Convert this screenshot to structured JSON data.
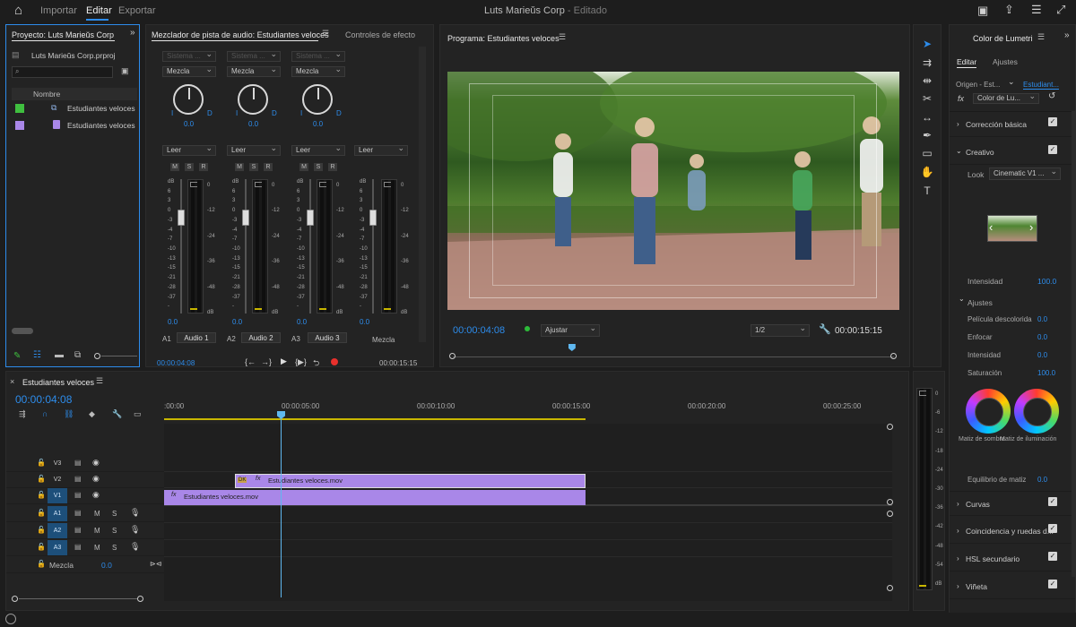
{
  "header": {
    "nav": [
      "Importar",
      "Editar",
      "Exportar"
    ],
    "title": "Luts Marieŭs Corp",
    "title_status": " - Editado"
  },
  "project": {
    "tab": "Proyecto: Luts Marieŭs Corp",
    "file": "Luts Marieŭs Corp.prproj",
    "column": "Nombre",
    "items": [
      {
        "name": "Estudiantes veloces",
        "color": "#3fbf3f"
      },
      {
        "name": "Estudiantes veloces",
        "color": "#a987e8"
      }
    ]
  },
  "mixer": {
    "tab": "Mezclador de pista de audio: Estudiantes veloces",
    "tab2": "Controles de efecto",
    "sistema": "Sistema ...",
    "mezcla": "Mezcla",
    "leer": "Leer",
    "msr": [
      "M",
      "S",
      "R"
    ],
    "pan_value": "0.0",
    "pan_l": "I",
    "pan_r": "D",
    "fader_value": "0.0",
    "fader_scale": [
      "dB",
      "6",
      "3",
      "0",
      "-3",
      "-4",
      "-7",
      "-10",
      "-13",
      "-15",
      "-21",
      "-28",
      "-37",
      "-"
    ],
    "meter_scale": [
      "0",
      "-12",
      "-24",
      "-36",
      "-48",
      "dB"
    ],
    "channels": [
      {
        "id": "A1",
        "name": "Audio 1"
      },
      {
        "id": "A2",
        "name": "Audio 2"
      },
      {
        "id": "A3",
        "name": "Audio 3"
      }
    ],
    "master_name": "Mezcla",
    "time_left": "00:00:04:08",
    "time_right": "00:00:15:15"
  },
  "program": {
    "tab": "Programa: Estudiantes veloces",
    "timecode": "00:00:04:08",
    "fit": "Ajustar",
    "resolution": "1/2",
    "duration": "00:00:15:15",
    "playhead_fraction": 0.27
  },
  "timeline": {
    "tab": "Estudiantes veloces",
    "timecode": "00:00:04:08",
    "ruler": [
      ":00:00",
      "00:00:05:00",
      "00:00:10:00",
      "00:00:15:00",
      "00:00:20:00",
      "00:00:25:00"
    ],
    "tracks_video": [
      "V3",
      "V2",
      "V1"
    ],
    "tracks_audio": [
      "A1",
      "A2",
      "A3"
    ],
    "track_buttons": [
      "M",
      "S"
    ],
    "mix_label": "Mezcla",
    "mix_value": "0.0",
    "clip_fx": "fx",
    "clip_v2": "Estudiantes veloces.mov",
    "clip_v1": "Estudiantes veloces.mov",
    "clip_badge": "DK",
    "clip_color": "#a987e8",
    "playhead_color": "#5fb8f0",
    "meter_scale": [
      "0",
      "-6",
      "-12",
      "-18",
      "-24",
      "-30",
      "-36",
      "-42",
      "-48",
      "-54",
      "dB"
    ]
  },
  "lumetri": {
    "tab": "Color de Lumetri",
    "subtabs": [
      "Editar",
      "Ajustes"
    ],
    "origin": "Origen - Est...",
    "origin_clip": "Estudiant...",
    "fx_label": "fx",
    "fx_dropdown": "Color de Lu...",
    "sections": {
      "basic": "Corrección básica",
      "creative": "Creativo",
      "curves": "Curvas",
      "match": "Coincidencia y ruedas d...",
      "hsl": "HSL secundario",
      "vignette": "Viñeta"
    },
    "look_label": "Look",
    "look_value": "Cinematic V1 ...",
    "intensity_label": "Intensidad",
    "intensity_value": "100.0",
    "adjust_label": "Ajustes",
    "adjust_rows": [
      {
        "label": "Película descolorida",
        "value": "0.0"
      },
      {
        "label": "Enfocar",
        "value": "0.0"
      },
      {
        "label": "Intensidad",
        "value": "0.0"
      },
      {
        "label": "Saturación",
        "value": "100.0"
      }
    ],
    "wheel_shadows": "Matiz de sombra",
    "wheel_highlights": "Matiz de iluminación",
    "balance_label": "Equilibrio de matiz",
    "balance_value": "0.0"
  }
}
